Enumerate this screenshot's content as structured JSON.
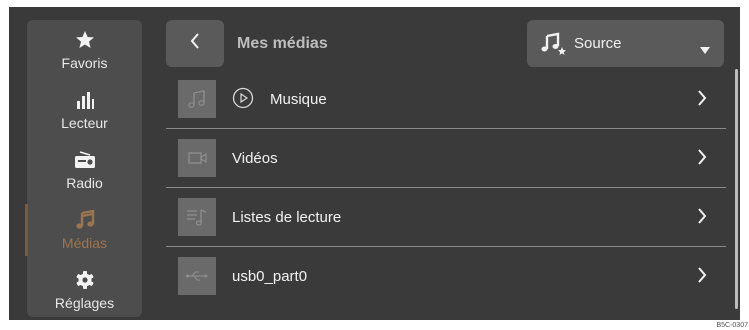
{
  "sidebar": {
    "items": [
      {
        "label": "Favoris",
        "icon": "star-icon"
      },
      {
        "label": "Lecteur",
        "icon": "equalizer-icon"
      },
      {
        "label": "Radio",
        "icon": "radio-icon"
      },
      {
        "label": "Médias",
        "icon": "music-note-icon",
        "active": true
      },
      {
        "label": "Réglages",
        "icon": "gear-icon"
      }
    ],
    "active_color": "#9b7450"
  },
  "header": {
    "title": "Mes médias",
    "source_label": "Source"
  },
  "list": {
    "items": [
      {
        "label": "Musique",
        "icon": "music-file-icon"
      },
      {
        "label": "Vidéos",
        "icon": "video-icon"
      },
      {
        "label": "Listes de lecture",
        "icon": "playlist-icon"
      },
      {
        "label": "usb0_part0",
        "icon": "usb-icon"
      }
    ]
  },
  "figure_code": "B5C-0307"
}
